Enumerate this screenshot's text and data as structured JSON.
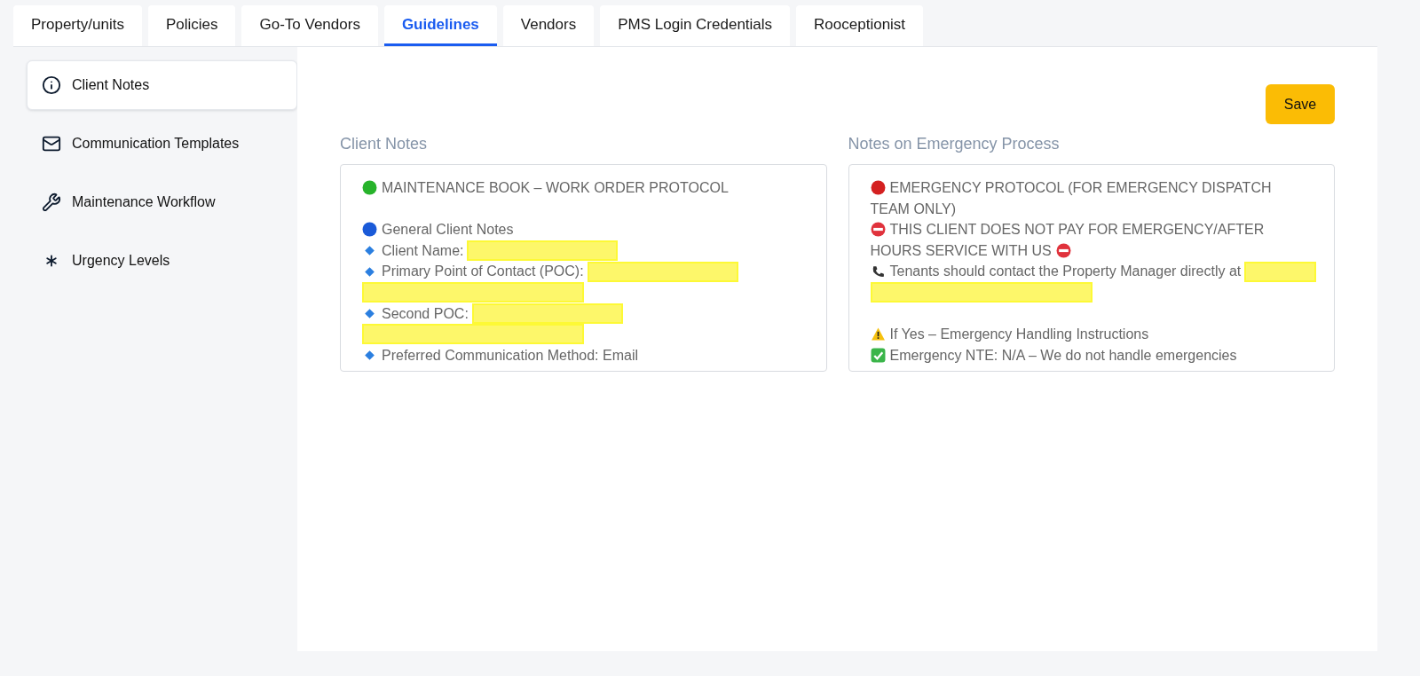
{
  "tabs": [
    {
      "label": "Property/units",
      "selected": false
    },
    {
      "label": "Policies",
      "selected": false
    },
    {
      "label": "Go-To Vendors",
      "selected": false
    },
    {
      "label": "Guidelines",
      "selected": true
    },
    {
      "label": "Vendors",
      "selected": false
    },
    {
      "label": "PMS Login Credentials",
      "selected": false
    },
    {
      "label": "Rooceptionist",
      "selected": false
    }
  ],
  "sidebar": {
    "items": [
      {
        "label": "Client Notes",
        "selected": true
      },
      {
        "label": "Communication Templates",
        "selected": false
      },
      {
        "label": "Maintenance Workflow",
        "selected": false
      },
      {
        "label": "Urgency Levels",
        "selected": false
      }
    ]
  },
  "save_button": "Save",
  "panels": [
    {
      "title": "Client Notes",
      "lines": [
        {
          "kind": "ok",
          "text": "MAINTENANCE BOOK – WORK ORDER PROTOCOL"
        },
        {
          "kind": "blank"
        },
        {
          "kind": "section",
          "text": "General Client Notes"
        },
        {
          "kind": "bullet",
          "text": "Client Name:",
          "redacted": true
        },
        {
          "kind": "bullet",
          "text": "Primary Point of Contact (POC):",
          "redacted": true
        },
        {
          "kind": "redaction"
        },
        {
          "kind": "bullet",
          "text": "Second POC:",
          "redacted": true
        },
        {
          "kind": "redaction"
        },
        {
          "kind": "bullet",
          "text": "Preferred Communication Method: Email"
        }
      ]
    },
    {
      "title": "Notes on Emergency Process",
      "lines": [
        {
          "kind": "alert",
          "text": "EMERGENCY PROTOCOL (FOR EMERGENCY DISPATCH"
        },
        {
          "kind": "continued",
          "text": "TEAM ONLY)"
        },
        {
          "kind": "blocked",
          "text": "THIS CLIENT DOES NOT PAY FOR EMERGENCY/AFTER"
        },
        {
          "kind": "continued",
          "text": "HOURS SERVICE WITH US",
          "trailing_icon": true
        },
        {
          "kind": "phone",
          "text": "Tenants should contact the Property Manager directly at",
          "redacted": true
        },
        {
          "kind": "redaction"
        },
        {
          "kind": "blank"
        },
        {
          "kind": "warning",
          "text": "If Yes – Emergency Handling Instructions"
        },
        {
          "kind": "check",
          "text": "Emergency NTE: N/A – We do not handle emergencies"
        }
      ]
    }
  ]
}
